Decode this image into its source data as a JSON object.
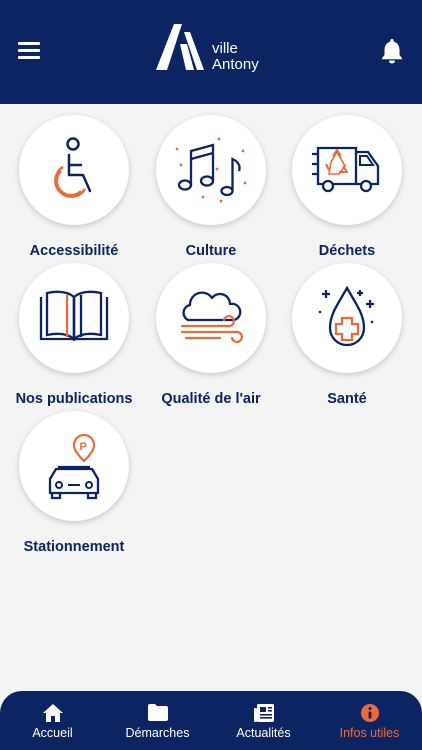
{
  "header": {
    "logo_line1": "ville",
    "logo_line2": "Antony",
    "icons": [
      "menu-icon",
      "bell-icon"
    ]
  },
  "tiles": [
    {
      "label": "Accessibilité",
      "icon": "wheelchair-icon"
    },
    {
      "label": "Culture",
      "icon": "music-notes-icon"
    },
    {
      "label": "Déchets",
      "icon": "garbage-truck-icon"
    },
    {
      "label": "Nos publications",
      "icon": "open-book-icon"
    },
    {
      "label": "Qualité de l'air",
      "icon": "cloud-wind-icon"
    },
    {
      "label": "Santé",
      "icon": "blood-drop-cross-icon"
    },
    {
      "label": "Stationnement",
      "icon": "parking-car-icon"
    }
  ],
  "tabbar": {
    "tabs": [
      {
        "label": "Accueil",
        "icon": "home-icon",
        "active": false
      },
      {
        "label": "Démarches",
        "icon": "folder-icon",
        "active": false
      },
      {
        "label": "Actualités",
        "icon": "newspaper-icon",
        "active": false
      },
      {
        "label": "Infos utiles",
        "icon": "info-icon",
        "active": true
      }
    ]
  },
  "colors": {
    "primary": "#0d2462",
    "accent": "#e86b3c",
    "background": "#f4f4f4"
  }
}
